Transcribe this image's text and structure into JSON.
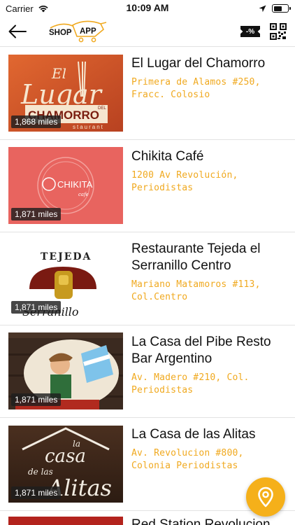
{
  "status_bar": {
    "carrier": "Carrier",
    "time": "10:09 AM"
  },
  "navbar": {
    "logo_text_left": "SHOP",
    "logo_text_right": "APP",
    "discount_badge": "-%"
  },
  "colors": {
    "accent": "#f0a91f",
    "fab": "#f5b01a"
  },
  "restaurants": [
    {
      "name": "El Lugar del Chamorro",
      "address": "Primera de Alamos #250, Fracc. Colosio",
      "distance": "1,868 miles",
      "image_text": [
        "El",
        "Lugar",
        "DEL",
        "CHAMORRO",
        "staurant"
      ]
    },
    {
      "name": "Chikita Café",
      "address": "1200 Av Revolución, Periodistas",
      "distance": "1,871 miles",
      "image_text": [
        "CHIKITA",
        "cafe"
      ]
    },
    {
      "name": "Restaurante Tejeda el Serranillo Centro",
      "address": "Mariano Matamoros #113, Col.Centro",
      "distance": "1,871 miles",
      "image_text": [
        "TEJEDA",
        "Serranillo"
      ]
    },
    {
      "name": "La Casa del Pibe Resto Bar Argentino",
      "address": "Av. Madero #210, Col. Periodistas",
      "distance": "1,871 miles",
      "image_text": []
    },
    {
      "name": "La Casa de las Alitas",
      "address": "Av. Revolucion #800, Colonia Periodistas",
      "distance": "1,871 miles",
      "image_text": [
        "la",
        "casa",
        "de las",
        "Alitas"
      ]
    }
  ],
  "partial_item": {
    "name": "Red Station Revolucion"
  }
}
